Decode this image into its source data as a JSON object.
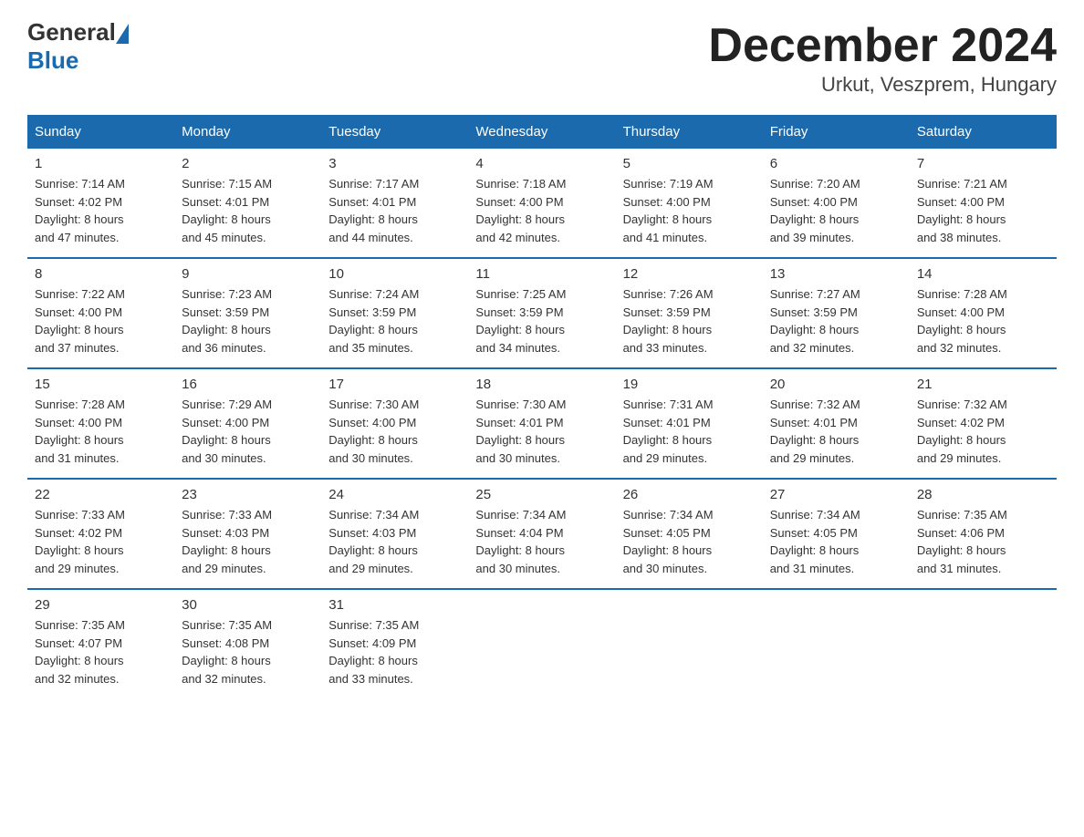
{
  "header": {
    "logo_general": "General",
    "logo_blue": "Blue",
    "title": "December 2024",
    "subtitle": "Urkut, Veszprem, Hungary"
  },
  "days_of_week": [
    "Sunday",
    "Monday",
    "Tuesday",
    "Wednesday",
    "Thursday",
    "Friday",
    "Saturday"
  ],
  "weeks": [
    [
      {
        "day": "1",
        "sunrise": "7:14 AM",
        "sunset": "4:02 PM",
        "daylight": "8 hours and 47 minutes."
      },
      {
        "day": "2",
        "sunrise": "7:15 AM",
        "sunset": "4:01 PM",
        "daylight": "8 hours and 45 minutes."
      },
      {
        "day": "3",
        "sunrise": "7:17 AM",
        "sunset": "4:01 PM",
        "daylight": "8 hours and 44 minutes."
      },
      {
        "day": "4",
        "sunrise": "7:18 AM",
        "sunset": "4:00 PM",
        "daylight": "8 hours and 42 minutes."
      },
      {
        "day": "5",
        "sunrise": "7:19 AM",
        "sunset": "4:00 PM",
        "daylight": "8 hours and 41 minutes."
      },
      {
        "day": "6",
        "sunrise": "7:20 AM",
        "sunset": "4:00 PM",
        "daylight": "8 hours and 39 minutes."
      },
      {
        "day": "7",
        "sunrise": "7:21 AM",
        "sunset": "4:00 PM",
        "daylight": "8 hours and 38 minutes."
      }
    ],
    [
      {
        "day": "8",
        "sunrise": "7:22 AM",
        "sunset": "4:00 PM",
        "daylight": "8 hours and 37 minutes."
      },
      {
        "day": "9",
        "sunrise": "7:23 AM",
        "sunset": "3:59 PM",
        "daylight": "8 hours and 36 minutes."
      },
      {
        "day": "10",
        "sunrise": "7:24 AM",
        "sunset": "3:59 PM",
        "daylight": "8 hours and 35 minutes."
      },
      {
        "day": "11",
        "sunrise": "7:25 AM",
        "sunset": "3:59 PM",
        "daylight": "8 hours and 34 minutes."
      },
      {
        "day": "12",
        "sunrise": "7:26 AM",
        "sunset": "3:59 PM",
        "daylight": "8 hours and 33 minutes."
      },
      {
        "day": "13",
        "sunrise": "7:27 AM",
        "sunset": "3:59 PM",
        "daylight": "8 hours and 32 minutes."
      },
      {
        "day": "14",
        "sunrise": "7:28 AM",
        "sunset": "4:00 PM",
        "daylight": "8 hours and 32 minutes."
      }
    ],
    [
      {
        "day": "15",
        "sunrise": "7:28 AM",
        "sunset": "4:00 PM",
        "daylight": "8 hours and 31 minutes."
      },
      {
        "day": "16",
        "sunrise": "7:29 AM",
        "sunset": "4:00 PM",
        "daylight": "8 hours and 30 minutes."
      },
      {
        "day": "17",
        "sunrise": "7:30 AM",
        "sunset": "4:00 PM",
        "daylight": "8 hours and 30 minutes."
      },
      {
        "day": "18",
        "sunrise": "7:30 AM",
        "sunset": "4:01 PM",
        "daylight": "8 hours and 30 minutes."
      },
      {
        "day": "19",
        "sunrise": "7:31 AM",
        "sunset": "4:01 PM",
        "daylight": "8 hours and 29 minutes."
      },
      {
        "day": "20",
        "sunrise": "7:32 AM",
        "sunset": "4:01 PM",
        "daylight": "8 hours and 29 minutes."
      },
      {
        "day": "21",
        "sunrise": "7:32 AM",
        "sunset": "4:02 PM",
        "daylight": "8 hours and 29 minutes."
      }
    ],
    [
      {
        "day": "22",
        "sunrise": "7:33 AM",
        "sunset": "4:02 PM",
        "daylight": "8 hours and 29 minutes."
      },
      {
        "day": "23",
        "sunrise": "7:33 AM",
        "sunset": "4:03 PM",
        "daylight": "8 hours and 29 minutes."
      },
      {
        "day": "24",
        "sunrise": "7:34 AM",
        "sunset": "4:03 PM",
        "daylight": "8 hours and 29 minutes."
      },
      {
        "day": "25",
        "sunrise": "7:34 AM",
        "sunset": "4:04 PM",
        "daylight": "8 hours and 30 minutes."
      },
      {
        "day": "26",
        "sunrise": "7:34 AM",
        "sunset": "4:05 PM",
        "daylight": "8 hours and 30 minutes."
      },
      {
        "day": "27",
        "sunrise": "7:34 AM",
        "sunset": "4:05 PM",
        "daylight": "8 hours and 31 minutes."
      },
      {
        "day": "28",
        "sunrise": "7:35 AM",
        "sunset": "4:06 PM",
        "daylight": "8 hours and 31 minutes."
      }
    ],
    [
      {
        "day": "29",
        "sunrise": "7:35 AM",
        "sunset": "4:07 PM",
        "daylight": "8 hours and 32 minutes."
      },
      {
        "day": "30",
        "sunrise": "7:35 AM",
        "sunset": "4:08 PM",
        "daylight": "8 hours and 32 minutes."
      },
      {
        "day": "31",
        "sunrise": "7:35 AM",
        "sunset": "4:09 PM",
        "daylight": "8 hours and 33 minutes."
      },
      null,
      null,
      null,
      null
    ]
  ],
  "labels": {
    "sunrise": "Sunrise:",
    "sunset": "Sunset:",
    "daylight": "Daylight:"
  }
}
